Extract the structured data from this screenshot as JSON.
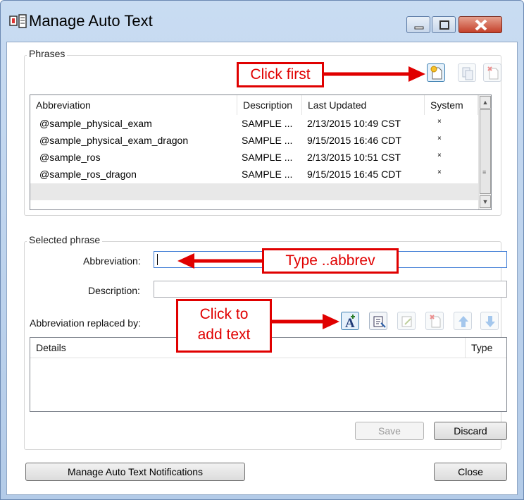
{
  "window": {
    "title": "Manage Auto Text"
  },
  "phrases": {
    "group_label": "Phrases",
    "columns": [
      "Abbreviation",
      "Description",
      "Last Updated",
      "System"
    ],
    "rows": [
      {
        "abbreviation": "@sample_physical_exam",
        "description": "SAMPLE ...",
        "last_updated": "2/13/2015 10:49 CST",
        "system": "×"
      },
      {
        "abbreviation": "@sample_physical_exam_dragon",
        "description": "SAMPLE ...",
        "last_updated": "9/15/2015 16:46 CDT",
        "system": "×"
      },
      {
        "abbreviation": "@sample_ros",
        "description": "SAMPLE ...",
        "last_updated": "2/13/2015 10:51 CST",
        "system": "×"
      },
      {
        "abbreviation": "@sample_ros_dragon",
        "description": "SAMPLE ...",
        "last_updated": "9/15/2015 16:45 CDT",
        "system": "×"
      }
    ]
  },
  "selected": {
    "group_label": "Selected phrase",
    "abbreviation_label": "Abbreviation:",
    "abbreviation_value": "",
    "description_label": "Description:",
    "description_value": "",
    "replaced_by_label": "Abbreviation replaced by:",
    "details_columns": [
      "Details",
      "Type"
    ],
    "save_label": "Save",
    "discard_label": "Discard"
  },
  "footer": {
    "manage_notifications_label": "Manage Auto Text Notifications",
    "close_label": "Close"
  },
  "annotations": {
    "click_first": "Click first",
    "type_abbrev": "Type ..abbrev",
    "click_to_add_line1": "Click to",
    "click_to_add_line2": "add text"
  },
  "colors": {
    "annotation_red": "#e00000",
    "selection_row": "#e8e8e8"
  }
}
